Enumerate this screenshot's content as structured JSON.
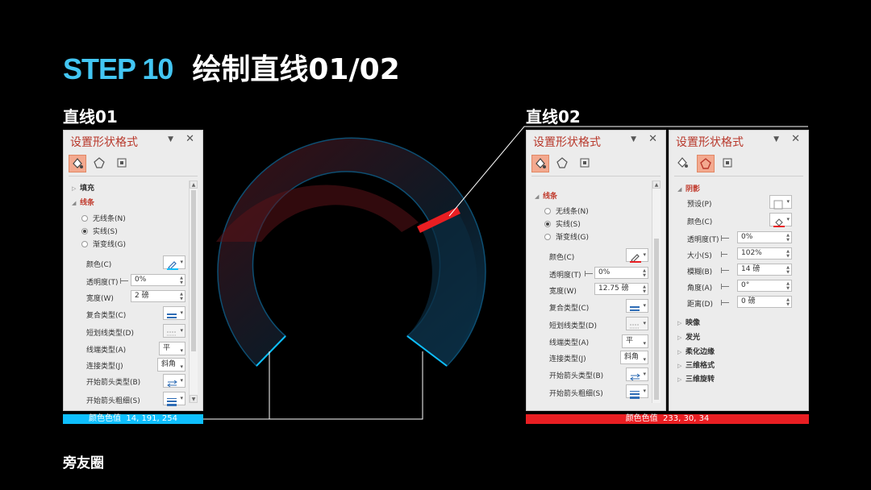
{
  "title": {
    "step": "STEP 10",
    "text": "绘制直线01/02"
  },
  "line01": {
    "label": "直线01",
    "color_caption": "颜色色值",
    "color_value": "14, 191, 254",
    "color": "#0ebffe"
  },
  "line02": {
    "label": "直线02",
    "color_caption": "颜色色值",
    "color_value": "233, 30, 34",
    "color": "#e91e22"
  },
  "panel": {
    "title": "设置形状格式"
  },
  "panel1": {
    "fill": "填充",
    "line": "线条",
    "no_line": "无线条(N)",
    "solid_line": "实线(S)",
    "gradient_line": "渐变线(G)",
    "color": "颜色(C)",
    "transparency": "透明度(T)",
    "transparency_value": "0%",
    "width": "宽度(W)",
    "width_value": "2 磅",
    "compound": "复合类型(C)",
    "dash": "短划线类型(D)",
    "cap": "线端类型(A)",
    "cap_value": "平",
    "join": "连接类型(J)",
    "join_value": "斜角",
    "arrow_start_type": "开始箭头类型(B)",
    "arrow_start_size": "开始箭头粗细(S)"
  },
  "panel2": {
    "line": "线条",
    "no_line": "无线条(N)",
    "solid_line": "实线(S)",
    "gradient_line": "渐变线(G)",
    "color": "颜色(C)",
    "transparency": "透明度(T)",
    "transparency_value": "0%",
    "width": "宽度(W)",
    "width_value": "12.75 磅",
    "compound": "复合类型(C)",
    "dash": "短划线类型(D)",
    "cap": "线端类型(A)",
    "cap_value": "平",
    "join": "连接类型(J)",
    "join_value": "斜角",
    "arrow_start_type": "开始箭头类型(B)",
    "arrow_start_size": "开始箭头粗细(S)"
  },
  "panel3": {
    "shadow": "阴影",
    "preset": "预设(P)",
    "color": "颜色(C)",
    "transparency": "透明度(T)",
    "transparency_value": "0%",
    "size": "大小(S)",
    "size_value": "102%",
    "blur": "模糊(B)",
    "blur_value": "14 磅",
    "angle": "角度(A)",
    "angle_value": "0°",
    "distance": "距离(D)",
    "distance_value": "0 磅",
    "reflection": "映像",
    "glow": "发光",
    "soft_edges": "柔化边缘",
    "format_3d": "三维格式",
    "rotation_3d": "三维旋转"
  },
  "brand": "旁友圈",
  "icons": [
    "fill-line-icon",
    "effects-icon",
    "size-properties-icon",
    "pin-dropdown-icon",
    "close-icon",
    "color-picker-icon",
    "compound-type-icon",
    "dash-type-icon",
    "arrow-type-icon"
  ]
}
